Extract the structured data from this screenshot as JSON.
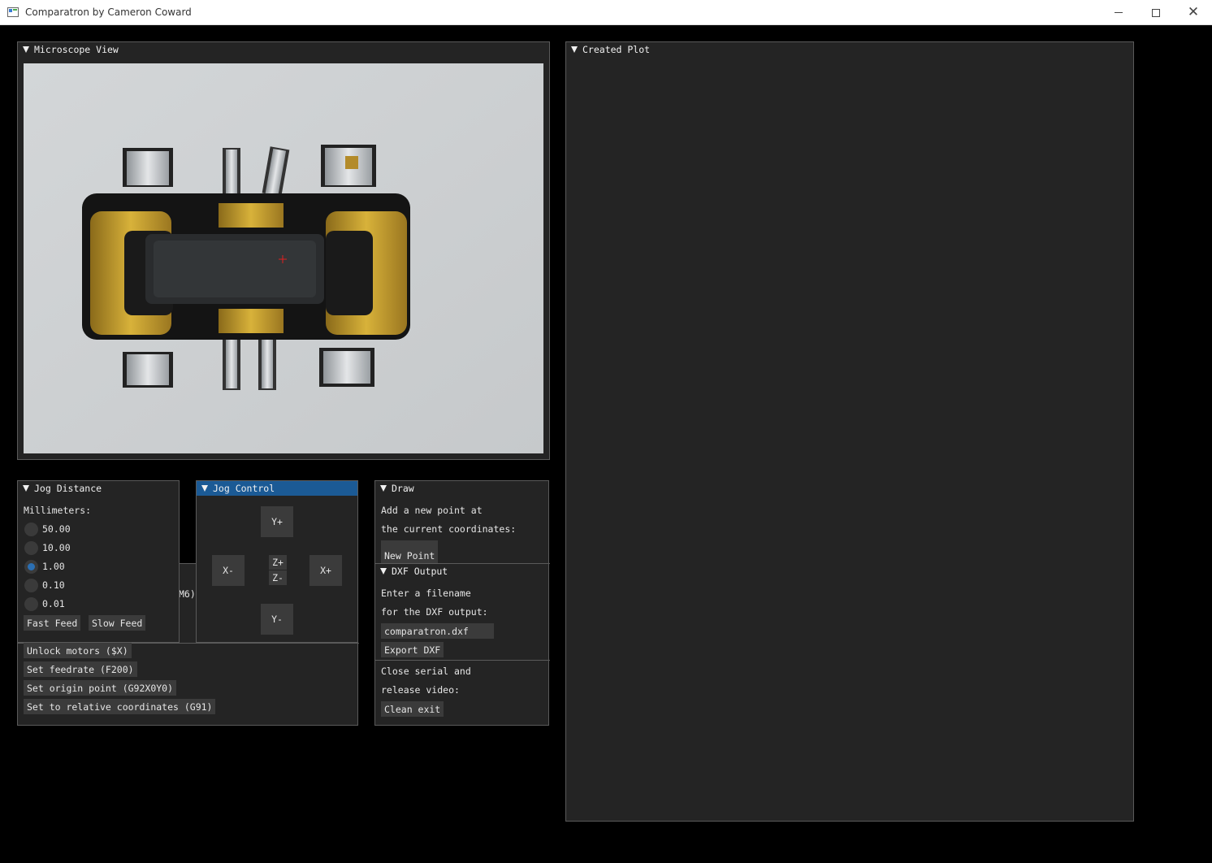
{
  "window": {
    "title": "Comparatron by Cameron Coward",
    "icons": {
      "app": "app-window-icon",
      "minimize": "minimize-icon",
      "maximize": "maximize-icon",
      "close": "close-icon"
    }
  },
  "microscope": {
    "header": "Microscope View"
  },
  "created_plot": {
    "header": "Created Plot"
  },
  "jog_distance": {
    "header": "Jog Distance",
    "units_label": "Millimeters:",
    "options": [
      "50.00",
      "10.00",
      "1.00",
      "0.10",
      "0.01"
    ],
    "selected": "1.00",
    "fast_feed": "Fast Feed",
    "slow_feed": "Slow Feed"
  },
  "jog_control": {
    "header": "Jog Control",
    "y_plus": "Y+",
    "y_minus": "Y-",
    "x_plus": "X+",
    "x_minus": "X-",
    "z_plus": "Z+",
    "z_minus": "Z-",
    "hidden_fragment": "M6)"
  },
  "commands": {
    "unlock": "Unlock motors ($X)",
    "feedrate": "Set feedrate (F200)",
    "origin": "Set origin point (G92X0Y0)",
    "relative": "Set to relative coordinates (G91)"
  },
  "draw": {
    "header": "Draw",
    "line1": "Add a new point at",
    "line2": "the current coordinates:",
    "new_point": "New Point"
  },
  "dxf": {
    "header": "DXF Output",
    "line1": "Enter a filename",
    "line2": "for the DXF output:",
    "filename": "comparatron.dxf",
    "export": "Export DXF",
    "close_line1": "Close serial and",
    "close_line2": "release video:",
    "clean_exit": "Clean exit"
  },
  "colors": {
    "panel_bg": "#242424",
    "active_header": "#1b5a95",
    "button": "#3b3b3b",
    "radio_selected": "#2b6fb3"
  }
}
